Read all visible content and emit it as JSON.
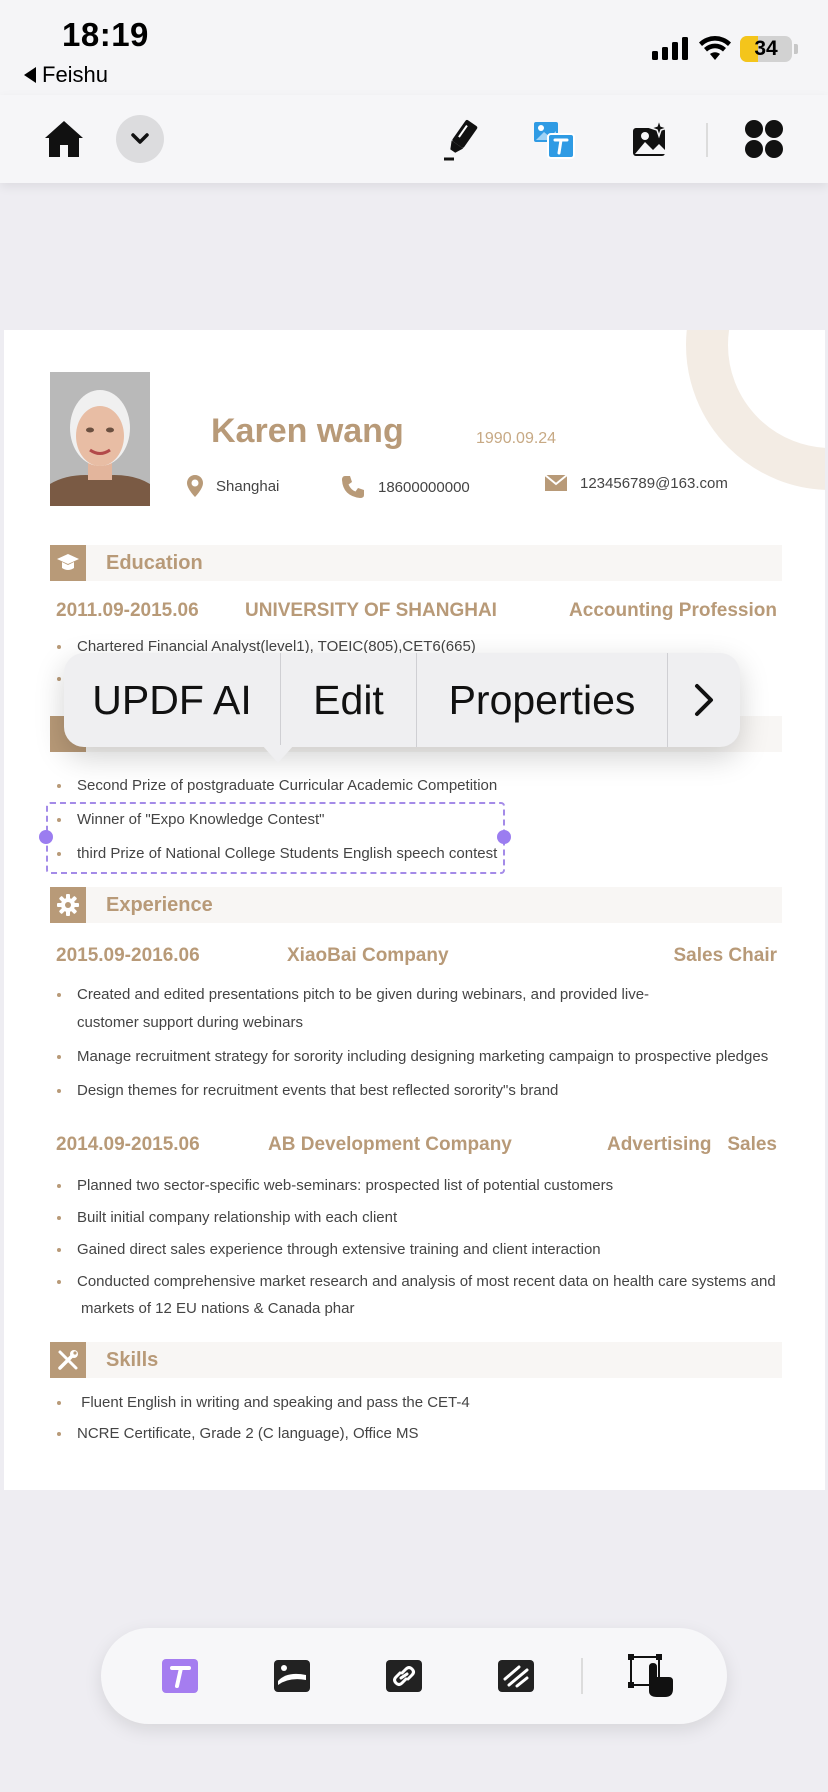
{
  "status_bar": {
    "time": "18:19",
    "back_app": "Feishu",
    "battery": "34",
    "battery_level": 0.34
  },
  "toolbar": {
    "icons": [
      "home-icon",
      "chevron-down-icon",
      "highlighter-icon",
      "image-text-icon",
      "image-edit-icon",
      "apps-grid-icon"
    ],
    "accent": "#2f9be4"
  },
  "resume": {
    "name": "Karen wang",
    "dob": "1990.09.24",
    "location": "Shanghai",
    "phone": "18600000000",
    "email": "123456789@163.com",
    "education": {
      "title": "Education",
      "period": "2011.09-2015.06",
      "school": "UNIVERSITY OF SHANGHAI",
      "major": "Accounting Profession",
      "bullets": [
        "Chartered Financial Analyst(level1), TOEIC(805),CET6(665)"
      ]
    },
    "awards": {
      "bullets": [
        "Second Prize of postgraduate Curricular Academic Competition",
        "Winner of \"Expo Knowledge Contest\"",
        "third Prize of National College Students English speech contest"
      ]
    },
    "experience": {
      "title": "Experience",
      "job1": {
        "period": "2015.09-2016.06",
        "company": "XiaoBai Company",
        "role": "Sales Chair",
        "bullet1": "Created and edited presentations pitch to be given during webinars, and provided live-",
        "bullet1_cont": "customer support during webinars",
        "bullet2": "Manage recruitment strategy for sorority including designing marketing campaign to prospective pledges",
        "bullet3": "Design themes for recruitment events that best reflected sorority\"s brand"
      },
      "job2": {
        "period": "2014.09-2015.06",
        "company": "AB Development Company",
        "role": "Advertising   Sales",
        "bullet1": "Planned two sector-specific web-seminars: prospected list of potential customers",
        "bullet2": "Built initial company relationship with each client",
        "bullet3": "Gained direct sales experience through extensive training and client interaction",
        "bullet4": "Conducted comprehensive market research and analysis of most recent data on health care systems and",
        "bullet4_cont": "markets of 12 EU nations & Canada phar"
      }
    },
    "skills": {
      "title": "Skills",
      "bullets": [
        " Fluent English in writing and speaking and pass the CET-4",
        "NCRE Certificate, Grade 2 (C language), Office MS"
      ]
    }
  },
  "context_menu": {
    "items": [
      "UPDF AI",
      "Edit",
      "Properties"
    ],
    "more_icon": "chevron-right-icon"
  },
  "bottom_bar": {
    "icons": [
      "text-tool-icon",
      "image-tool-icon",
      "link-tool-icon",
      "crop-tool-icon",
      "select-area-icon"
    ],
    "active_color": "#a57df0"
  }
}
